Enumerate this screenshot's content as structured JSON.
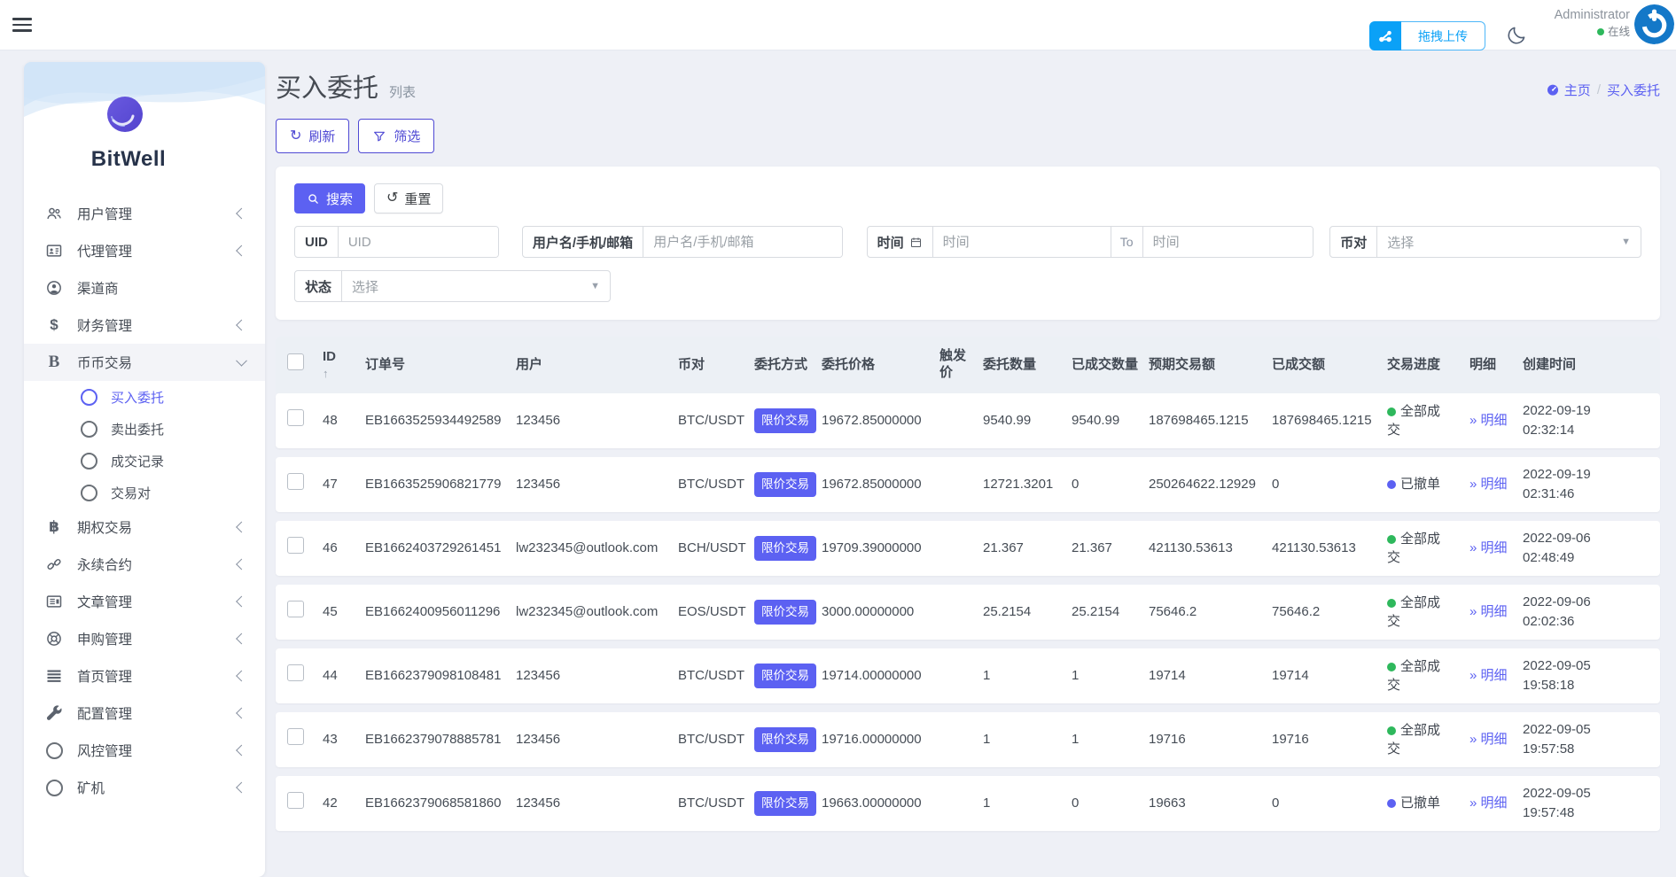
{
  "topbar": {
    "upload_label": "拖拽上传",
    "user_name": "Administrator",
    "user_status": "在线"
  },
  "sidebar": {
    "brand": "BitWell",
    "items": [
      {
        "key": "users",
        "label": "用户管理",
        "icon": "users-icon",
        "chevron": "left"
      },
      {
        "key": "agents",
        "label": "代理管理",
        "icon": "id-card-icon",
        "chevron": "left"
      },
      {
        "key": "channel",
        "label": "渠道商",
        "icon": "user-circle-icon",
        "chevron": ""
      },
      {
        "key": "finance",
        "label": "财务管理",
        "icon": "dollar-icon",
        "chevron": "left"
      },
      {
        "key": "spot-trade",
        "label": "币币交易",
        "icon": "coin-b-icon",
        "chevron": "down",
        "expanded": true,
        "children": [
          {
            "key": "buy-orders",
            "label": "买入委托",
            "active": true
          },
          {
            "key": "sell-orders",
            "label": "卖出委托",
            "active": false
          },
          {
            "key": "trade-records",
            "label": "成交记录",
            "active": false
          },
          {
            "key": "trading-pairs",
            "label": "交易对",
            "active": false
          }
        ]
      },
      {
        "key": "options-trade",
        "label": "期权交易",
        "icon": "btc-icon",
        "chevron": "left"
      },
      {
        "key": "perpetual",
        "label": "永续合约",
        "icon": "chain-icon",
        "chevron": "left"
      },
      {
        "key": "articles",
        "label": "文章管理",
        "icon": "article-icon",
        "chevron": "left"
      },
      {
        "key": "subscription",
        "label": "申购管理",
        "icon": "life-ring-icon",
        "chevron": "left"
      },
      {
        "key": "homepage",
        "label": "首页管理",
        "icon": "rows-icon",
        "chevron": "left"
      },
      {
        "key": "config",
        "label": "配置管理",
        "icon": "wrench-icon",
        "chevron": "left"
      },
      {
        "key": "risk",
        "label": "风控管理",
        "icon": "circle-icon",
        "chevron": "left"
      },
      {
        "key": "miner",
        "label": "矿机",
        "icon": "circle-icon",
        "chevron": "left"
      }
    ]
  },
  "page": {
    "title": "买入委托",
    "subtitle": "列表",
    "breadcrumb": {
      "home": "主页",
      "separator": "/",
      "current": "买入委托"
    }
  },
  "toolbar": {
    "refresh_label": "刷新",
    "filter_label": "筛选"
  },
  "filters": {
    "search_label": "搜索",
    "reset_label": "重置",
    "uid": {
      "label": "UID",
      "placeholder": "UID"
    },
    "user": {
      "label": "用户名/手机/邮箱",
      "placeholder": "用户名/手机/邮箱"
    },
    "time": {
      "label": "时间",
      "placeholder_from": "时间",
      "to": "To",
      "placeholder_to": "时间"
    },
    "pair": {
      "label": "币对",
      "placeholder": "选择"
    },
    "status": {
      "label": "状态",
      "placeholder": "选择"
    }
  },
  "table": {
    "columns": [
      "ID",
      "订单号",
      "用户",
      "币对",
      "委托方式",
      "委托价格",
      "触发价",
      "委托数量",
      "已成交数量",
      "预期交易额",
      "已成交额",
      "交易进度",
      "明细",
      "创建时间"
    ],
    "sort_arrow": "↑",
    "detail_label": "明细",
    "rows": [
      {
        "id": "48",
        "order_no": "EB1663525934492589",
        "user": "123456",
        "pair": "BTC/USDT",
        "type": "限价交易",
        "price": "19672.85000000",
        "trigger": "",
        "amount": "9540.99",
        "filled": "9540.99",
        "expected": "187698465.1215",
        "turnover": "187698465.1215",
        "status": "全部成交",
        "status_color": "green",
        "date": "2022-09-19",
        "time": "02:32:14"
      },
      {
        "id": "47",
        "order_no": "EB1663525906821779",
        "user": "123456",
        "pair": "BTC/USDT",
        "type": "限价交易",
        "price": "19672.85000000",
        "trigger": "",
        "amount": "12721.3201",
        "filled": "0",
        "expected": "250264622.12929",
        "turnover": "0",
        "status": "已撤单",
        "status_color": "indigo",
        "date": "2022-09-19",
        "time": "02:31:46"
      },
      {
        "id": "46",
        "order_no": "EB1662403729261451",
        "user": "lw232345@outlook.com",
        "pair": "BCH/USDT",
        "type": "限价交易",
        "price": "19709.39000000",
        "trigger": "",
        "amount": "21.367",
        "filled": "21.367",
        "expected": "421130.53613",
        "turnover": "421130.53613",
        "status": "全部成交",
        "status_color": "green",
        "date": "2022-09-06",
        "time": "02:48:49"
      },
      {
        "id": "45",
        "order_no": "EB1662400956011296",
        "user": "lw232345@outlook.com",
        "pair": "EOS/USDT",
        "type": "限价交易",
        "price": "3000.00000000",
        "trigger": "",
        "amount": "25.2154",
        "filled": "25.2154",
        "expected": "75646.2",
        "turnover": "75646.2",
        "status": "全部成交",
        "status_color": "green",
        "date": "2022-09-06",
        "time": "02:02:36"
      },
      {
        "id": "44",
        "order_no": "EB1662379098108481",
        "user": "123456",
        "pair": "BTC/USDT",
        "type": "限价交易",
        "price": "19714.00000000",
        "trigger": "",
        "amount": "1",
        "filled": "1",
        "expected": "19714",
        "turnover": "19714",
        "status": "全部成交",
        "status_color": "green",
        "date": "2022-09-05",
        "time": "19:58:18"
      },
      {
        "id": "43",
        "order_no": "EB1662379078885781",
        "user": "123456",
        "pair": "BTC/USDT",
        "type": "限价交易",
        "price": "19716.00000000",
        "trigger": "",
        "amount": "1",
        "filled": "1",
        "expected": "19716",
        "turnover": "19716",
        "status": "全部成交",
        "status_color": "green",
        "date": "2022-09-05",
        "time": "19:57:58"
      },
      {
        "id": "42",
        "order_no": "EB1662379068581860",
        "user": "123456",
        "pair": "BTC/USDT",
        "type": "限价交易",
        "price": "19663.00000000",
        "trigger": "",
        "amount": "1",
        "filled": "0",
        "expected": "19663",
        "turnover": "0",
        "status": "已撤单",
        "status_color": "indigo",
        "date": "2022-09-05",
        "time": "19:57:48"
      }
    ]
  },
  "colors": {
    "accent": "#5c61f2",
    "success": "#2eb85c",
    "upload_blue": "#0ba1f7",
    "status": {
      "green": "#2eb85c",
      "indigo": "#5c61f2"
    }
  }
}
